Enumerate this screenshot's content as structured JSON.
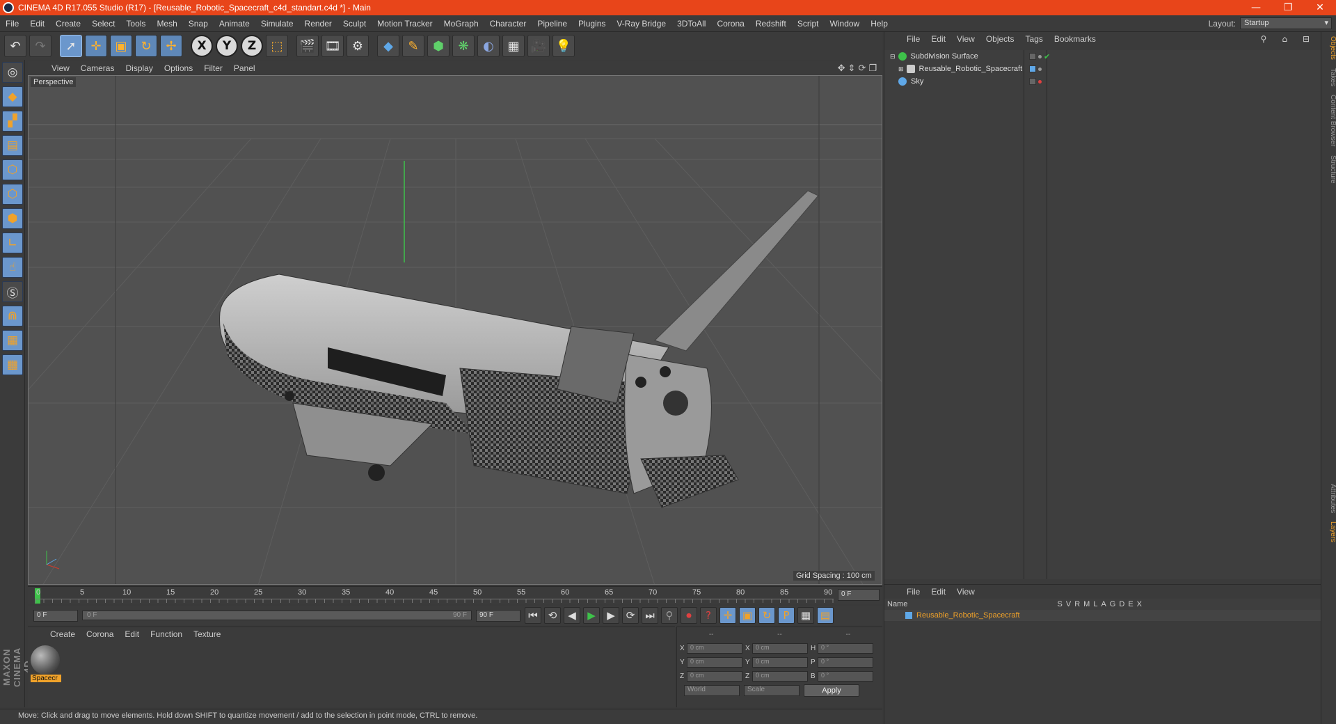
{
  "window": {
    "title": "CINEMA 4D R17.055 Studio (R17) - [Reusable_Robotic_Spacecraft_c4d_standart.c4d *] - Main",
    "controls": [
      "—",
      "❐",
      "✕"
    ]
  },
  "menubar": {
    "items": [
      "File",
      "Edit",
      "Create",
      "Select",
      "Tools",
      "Mesh",
      "Snap",
      "Animate",
      "Simulate",
      "Render",
      "Sculpt",
      "Motion Tracker",
      "MoGraph",
      "Character",
      "Pipeline",
      "Plugins",
      "V-Ray Bridge",
      "3DToAll",
      "Corona",
      "Redshift",
      "Script",
      "Window",
      "Help"
    ],
    "layout_label": "Layout:",
    "layout_value": "Startup"
  },
  "viewport": {
    "menu": [
      "View",
      "Cameras",
      "Display",
      "Options",
      "Filter",
      "Panel"
    ],
    "label": "Perspective",
    "grid_spacing": "Grid Spacing : 100 cm"
  },
  "timeline": {
    "ticks": [
      "0",
      "5",
      "10",
      "15",
      "20",
      "25",
      "30",
      "35",
      "40",
      "45",
      "50",
      "55",
      "60",
      "65",
      "70",
      "75",
      "80",
      "85",
      "90"
    ],
    "current_frame": "0 F",
    "start_field": "0 F",
    "slider_left": "0 F",
    "slider_right": "90 F",
    "end_field": "90 F"
  },
  "material_manager": {
    "menu": [
      "Create",
      "Corona",
      "Edit",
      "Function",
      "Texture"
    ],
    "material_name": "Spacecr"
  },
  "attributes": {
    "header": [
      "--",
      "--",
      "--"
    ],
    "rows": [
      {
        "a": "X",
        "av": "0 cm",
        "b": "X",
        "bv": "0 cm",
        "c": "H",
        "cv": "0 °"
      },
      {
        "a": "Y",
        "av": "0 cm",
        "b": "Y",
        "bv": "0 cm",
        "c": "P",
        "cv": "0 °"
      },
      {
        "a": "Z",
        "av": "0 cm",
        "b": "Z",
        "bv": "0 cm",
        "c": "B",
        "cv": "0 °"
      }
    ],
    "coord_mode": "World",
    "scale_mode": "Scale",
    "apply_label": "Apply"
  },
  "status": {
    "text": "Move: Click and drag to move elements. Hold down SHIFT to quantize movement / add to the selection in point mode, CTRL to remove."
  },
  "object_manager": {
    "menu": [
      "File",
      "Edit",
      "View",
      "Objects",
      "Tags",
      "Bookmarks"
    ],
    "objects": [
      {
        "name": "Subdivision Surface",
        "icon_color": "#3ec24a"
      },
      {
        "name": "Reusable_Robotic_Spacecraft",
        "icon_color": "#cccccc"
      },
      {
        "name": "Sky",
        "icon_color": "#5fa8e8"
      }
    ]
  },
  "layer_manager": {
    "menu": [
      "File",
      "Edit",
      "View"
    ],
    "name_header": "Name",
    "columns": [
      "S",
      "V",
      "R",
      "M",
      "L",
      "A",
      "G",
      "D",
      "E",
      "X"
    ],
    "layer_name": "Reusable_Robotic_Spacecraft"
  },
  "side_tabs": [
    "Objects",
    "Takes",
    "Content Browser",
    "Structure",
    "Attributes",
    "Layers"
  ],
  "brand": "MAXON CINEMA 4D",
  "colors": {
    "accent": "#f0a22a",
    "title_bar": "#e8451a",
    "selection_blue": "#6b97cc"
  }
}
